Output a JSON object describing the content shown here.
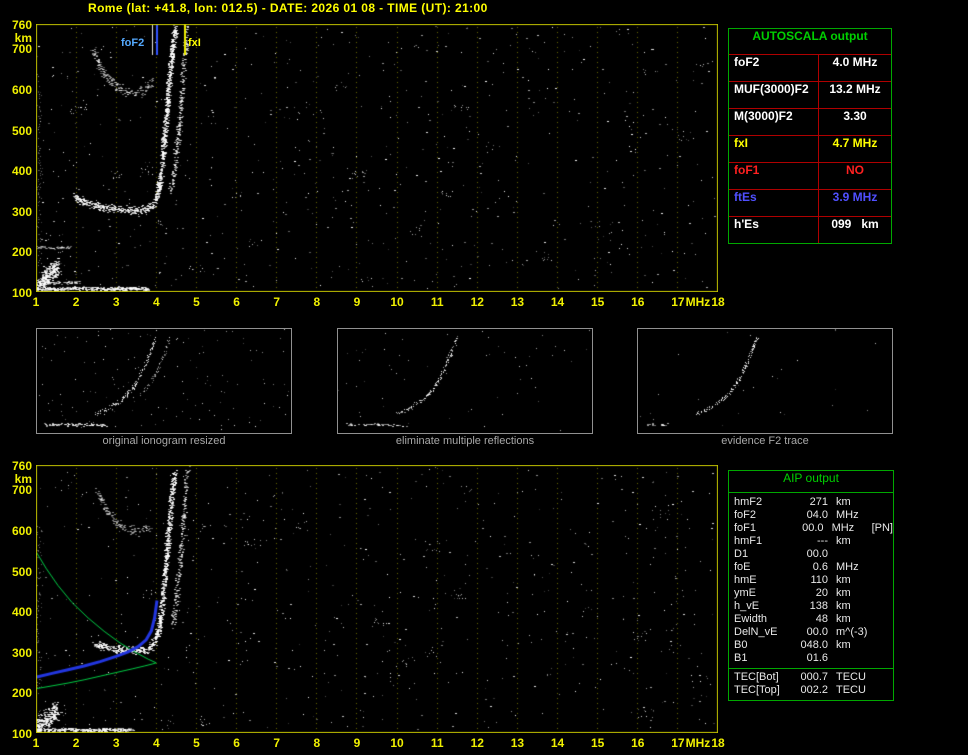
{
  "header": {
    "title": "Rome (lat: +41.8, lon: 012.5) - DATE: 2026 01 08 - TIME (UT): 21:00"
  },
  "autoscala_table": {
    "title": "AUTOSCALA output",
    "rows": [
      {
        "label": "foF2",
        "value": "4.0 MHz",
        "color": "#ffffff"
      },
      {
        "label": "MUF(3000)F2",
        "value": "13.2 MHz",
        "color": "#ffffff"
      },
      {
        "label": "M(3000)F2",
        "value": "3.30",
        "color": "#ffffff"
      },
      {
        "label": "fxI",
        "value": "4.7 MHz",
        "color": "#ffff00"
      },
      {
        "label": "foF1",
        "value": "NO",
        "color": "#ff2020"
      },
      {
        "label": "ftEs",
        "value": "3.9 MHz",
        "color": "#5050ff"
      },
      {
        "label": "h'Es",
        "value": "099   km",
        "color": "#ffffff"
      }
    ]
  },
  "aip_table": {
    "title": "AIP output",
    "rows": [
      {
        "label": "hmF2",
        "value": "271",
        "unit": "km",
        "extra": ""
      },
      {
        "label": "foF2",
        "value": "04.0",
        "unit": "MHz",
        "extra": ""
      },
      {
        "label": "foF1",
        "value": "00.0",
        "unit": "MHz",
        "extra": "[PN]"
      },
      {
        "label": "hmF1",
        "value": "---",
        "unit": "km",
        "extra": ""
      },
      {
        "label": "D1",
        "value": "00.0",
        "unit": "",
        "extra": ""
      },
      {
        "label": "foE",
        "value": "0.6",
        "unit": "MHz",
        "extra": ""
      },
      {
        "label": "hmE",
        "value": "110",
        "unit": "km",
        "extra": ""
      },
      {
        "label": "ymE",
        "value": "20",
        "unit": "km",
        "extra": ""
      },
      {
        "label": "h_vE",
        "value": "138",
        "unit": "km",
        "extra": ""
      },
      {
        "label": "Ewidth",
        "value": "48",
        "unit": "km",
        "extra": ""
      },
      {
        "label": "DelN_vE",
        "value": "00.0",
        "unit": "m^(-3)",
        "extra": ""
      },
      {
        "label": "B0",
        "value": "048.0",
        "unit": "km",
        "extra": ""
      },
      {
        "label": "B1",
        "value": "01.6",
        "unit": "",
        "extra": ""
      }
    ],
    "tec_rows": [
      {
        "label": "TEC[Bot]",
        "value": "000.7",
        "unit": "TECU"
      },
      {
        "label": "TEC[Top]",
        "value": "002.2",
        "unit": "TECU"
      }
    ]
  },
  "thumbnails": [
    {
      "caption": "original ionogram resized",
      "seed": 777,
      "noise": 140,
      "traces": [
        {
          "points": [
            [
              0.47,
              0.08
            ],
            [
              0.45,
              0.2
            ],
            [
              0.43,
              0.33
            ],
            [
              0.405,
              0.46
            ],
            [
              0.375,
              0.58
            ],
            [
              0.335,
              0.68
            ],
            [
              0.285,
              0.76
            ],
            [
              0.23,
              0.82
            ]
          ],
          "spread": 2.5,
          "samples": 170,
          "bright": 0.95,
          "w": 1
        },
        {
          "points": [
            [
              0.52,
              0.1
            ],
            [
              0.5,
              0.25
            ],
            [
              0.475,
              0.4
            ],
            [
              0.445,
              0.53
            ],
            [
              0.41,
              0.64
            ]
          ],
          "spread": 2.5,
          "samples": 70,
          "bright": 0.6,
          "w": 1
        },
        {
          "points": [
            [
              0.03,
              0.92
            ],
            [
              0.15,
              0.92
            ],
            [
              0.27,
              0.93
            ]
          ],
          "spread": 1.5,
          "samples": 80,
          "bright": 0.9,
          "w": 2
        }
      ]
    },
    {
      "caption": "eliminate multiple reflections",
      "seed": 888,
      "noise": 60,
      "traces": [
        {
          "points": [
            [
              0.47,
              0.08
            ],
            [
              0.45,
              0.2
            ],
            [
              0.43,
              0.33
            ],
            [
              0.405,
              0.46
            ],
            [
              0.375,
              0.58
            ],
            [
              0.335,
              0.68
            ],
            [
              0.285,
              0.76
            ],
            [
              0.23,
              0.82
            ]
          ],
          "spread": 2.5,
          "samples": 150,
          "bright": 0.95,
          "w": 1
        },
        {
          "points": [
            [
              0.03,
              0.92
            ],
            [
              0.15,
              0.92
            ],
            [
              0.27,
              0.93
            ]
          ],
          "spread": 1.5,
          "samples": 45,
          "bright": 0.85,
          "w": 2
        }
      ]
    },
    {
      "caption": "evidence F2 trace",
      "seed": 999,
      "noise": 25,
      "traces": [
        {
          "points": [
            [
              0.47,
              0.08
            ],
            [
              0.45,
              0.2
            ],
            [
              0.43,
              0.33
            ],
            [
              0.405,
              0.46
            ],
            [
              0.375,
              0.58
            ],
            [
              0.335,
              0.68
            ],
            [
              0.285,
              0.76
            ],
            [
              0.23,
              0.82
            ]
          ],
          "spread": 2.2,
          "samples": 160,
          "bright": 1.0,
          "w": 1
        },
        {
          "points": [
            [
              0.03,
              0.92
            ],
            [
              0.12,
              0.92
            ]
          ],
          "spread": 1.5,
          "samples": 15,
          "bright": 0.8,
          "w": 2
        }
      ]
    }
  ],
  "chart_data": [
    {
      "id": "ionogram-autoscaled",
      "type": "scatter",
      "title": "ionogram with autoscaled characteristics",
      "xlabel": "MHz",
      "ylabel": "km",
      "xlim": [
        1,
        18
      ],
      "ylim": [
        100,
        760
      ],
      "xticks": [
        1,
        2,
        3,
        4,
        5,
        6,
        7,
        8,
        9,
        10,
        11,
        12,
        13,
        14,
        15,
        16,
        17,
        18
      ],
      "yticks": [
        760,
        700,
        600,
        500,
        400,
        300,
        200,
        100
      ],
      "grid": "dotted-vertical",
      "markers": [
        {
          "name": "foF2",
          "label": "foF2",
          "freq_mhz": 4.0,
          "color": "#3355ff",
          "companion": true
        },
        {
          "name": "fxI",
          "label": "fxI",
          "freq_mhz": 4.7,
          "color": "#eeee00",
          "companion": false
        }
      ],
      "noise": {
        "dots": 620,
        "clusters": 28,
        "seed": 20260108
      },
      "traces": [
        {
          "name": "F2-ordinary",
          "points": [
            [
              1.95,
              332
            ],
            [
              2.3,
              316
            ],
            [
              2.7,
              306
            ],
            [
              3.1,
              301
            ],
            [
              3.5,
              299
            ],
            [
              3.75,
              302
            ],
            [
              3.9,
              312
            ],
            [
              4.0,
              330
            ],
            [
              4.08,
              362
            ],
            [
              4.15,
              415
            ],
            [
              4.2,
              475
            ],
            [
              4.26,
              545
            ],
            [
              4.32,
              615
            ],
            [
              4.4,
              690
            ],
            [
              4.48,
              752
            ]
          ],
          "spread": 12,
          "samples": 950,
          "bright": 1.0,
          "w": 2
        },
        {
          "name": "F2-extraordinary",
          "points": [
            [
              4.35,
              340
            ],
            [
              4.45,
              395
            ],
            [
              4.53,
              465
            ],
            [
              4.6,
              545
            ],
            [
              4.67,
              630
            ],
            [
              4.74,
              715
            ],
            [
              4.78,
              755
            ]
          ],
          "spread": 10,
          "samples": 260,
          "bright": 0.85,
          "w": 2
        },
        {
          "name": "second-hop",
          "points": [
            [
              2.4,
              702
            ],
            [
              2.6,
              652
            ],
            [
              2.85,
              618
            ],
            [
              3.15,
              596
            ],
            [
              3.45,
              588
            ],
            [
              3.7,
              594
            ],
            [
              3.9,
              618
            ]
          ],
          "spread": 16,
          "samples": 200,
          "bright": 0.6,
          "w": 2
        },
        {
          "name": "Es-layer",
          "points": [
            [
              1.0,
              105
            ],
            [
              1.5,
              104
            ],
            [
              2.1,
              106
            ],
            [
              2.7,
              105
            ],
            [
              3.3,
              106
            ],
            [
              3.8,
              105
            ]
          ],
          "spread": 5,
          "samples": 380,
          "bright": 0.9,
          "w": 2
        },
        {
          "name": "Es-second",
          "points": [
            [
              1.0,
              121
            ],
            [
              1.5,
              120
            ],
            [
              2.1,
              121
            ]
          ],
          "spread": 4,
          "samples": 90,
          "bright": 0.6,
          "w": 2
        },
        {
          "name": "low-blob",
          "points": [
            [
              1.0,
              112
            ],
            [
              1.15,
              124
            ],
            [
              1.3,
              138
            ],
            [
              1.45,
              150
            ],
            [
              1.55,
              160
            ]
          ],
          "spread": 30,
          "samples": 300,
          "bright": 0.95,
          "w": 2
        },
        {
          "name": "left-clutter",
          "points": [
            [
              1.05,
              170
            ],
            [
              1.1,
              240
            ],
            [
              1.05,
              320
            ],
            [
              1.12,
              400
            ],
            [
              1.06,
              480
            ],
            [
              1.1,
              560
            ],
            [
              1.05,
              640
            ]
          ],
          "spread": 60,
          "samples": 110,
          "bright": 0.45,
          "w": 1
        },
        {
          "name": "dash-200km",
          "points": [
            [
              1.05,
              208
            ],
            [
              1.5,
              206
            ],
            [
              1.9,
              207
            ]
          ],
          "spread": 4,
          "samples": 60,
          "bright": 0.5,
          "w": 2
        }
      ]
    },
    {
      "id": "ionogram-profile",
      "type": "scatter",
      "title": "ionogram with AIP electron density profile",
      "xlabel": "MHz",
      "ylabel": "km",
      "xlim": [
        1,
        18
      ],
      "ylim": [
        100,
        760
      ],
      "xticks": [
        1,
        2,
        3,
        4,
        5,
        6,
        7,
        8,
        9,
        10,
        11,
        12,
        13,
        14,
        15,
        16,
        17,
        18
      ],
      "yticks": [
        760,
        700,
        600,
        500,
        400,
        300,
        200,
        100
      ],
      "grid": "dotted-vertical",
      "markers": [],
      "noise": {
        "dots": 560,
        "clusters": 26,
        "seed": 90210
      },
      "traces": [
        {
          "name": "F2-ordinary",
          "points": [
            [
              2.45,
              318
            ],
            [
              2.8,
              308
            ],
            [
              3.2,
              302
            ],
            [
              3.55,
              300
            ],
            [
              3.8,
              304
            ],
            [
              3.95,
              318
            ],
            [
              4.05,
              345
            ],
            [
              4.12,
              392
            ],
            [
              4.18,
              450
            ],
            [
              4.25,
              520
            ],
            [
              4.3,
              590
            ],
            [
              4.37,
              665
            ],
            [
              4.45,
              740
            ]
          ],
          "spread": 12,
          "samples": 800,
          "bright": 1.0,
          "w": 2
        },
        {
          "name": "F2-extraordinary",
          "points": [
            [
              4.4,
              360
            ],
            [
              4.5,
              430
            ],
            [
              4.58,
              510
            ],
            [
              4.66,
              600
            ],
            [
              4.73,
              690
            ],
            [
              4.78,
              750
            ]
          ],
          "spread": 10,
          "samples": 220,
          "bright": 0.8,
          "w": 2
        },
        {
          "name": "second-hop",
          "points": [
            [
              2.5,
              700
            ],
            [
              2.75,
              650
            ],
            [
              3.0,
              618
            ],
            [
              3.3,
              600
            ],
            [
              3.6,
              594
            ],
            [
              3.85,
              604
            ]
          ],
          "spread": 14,
          "samples": 150,
          "bright": 0.55,
          "w": 2
        },
        {
          "name": "Es-layer",
          "points": [
            [
              1.0,
              104
            ],
            [
              1.6,
              105
            ],
            [
              2.2,
              104
            ],
            [
              2.8,
              105
            ],
            [
              3.4,
              105
            ]
          ],
          "spread": 5,
          "samples": 320,
          "bright": 0.9,
          "w": 2
        },
        {
          "name": "low-blob",
          "points": [
            [
              1.0,
              112
            ],
            [
              1.2,
              126
            ],
            [
              1.4,
              142
            ],
            [
              1.55,
              155
            ]
          ],
          "spread": 26,
          "samples": 260,
          "bright": 0.95,
          "w": 2
        },
        {
          "name": "left-clutter",
          "points": [
            [
              1.05,
              170
            ],
            [
              1.1,
              250
            ],
            [
              1.05,
              340
            ],
            [
              1.12,
              430
            ],
            [
              1.06,
              520
            ],
            [
              1.1,
              610
            ]
          ],
          "spread": 55,
          "samples": 90,
          "bright": 0.45,
          "w": 1
        }
      ],
      "curves": [
        {
          "name": "electron-density-profile-topside",
          "color": "#00cc44",
          "width": 1,
          "points": [
            [
              1.0,
              546
            ],
            [
              1.25,
              505
            ],
            [
              1.55,
              462
            ],
            [
              1.9,
              420
            ],
            [
              2.3,
              382
            ],
            [
              2.7,
              349
            ],
            [
              3.1,
              320
            ],
            [
              3.5,
              296
            ],
            [
              3.8,
              280
            ],
            [
              4.0,
              271
            ]
          ]
        },
        {
          "name": "electron-density-profile-bottomside",
          "color": "#00cc44",
          "width": 1,
          "points": [
            [
              1.0,
              207
            ],
            [
              1.4,
              214
            ],
            [
              1.8,
              221
            ],
            [
              2.2,
              229
            ],
            [
              2.6,
              238
            ],
            [
              3.0,
              247
            ],
            [
              3.4,
              256
            ],
            [
              3.7,
              263
            ],
            [
              3.9,
              268
            ],
            [
              4.0,
              271
            ]
          ]
        },
        {
          "name": "restored-F2-trace",
          "color": "#2236e0",
          "width": 3,
          "points": [
            [
              1.02,
              236
            ],
            [
              1.4,
              245
            ],
            [
              1.8,
              254
            ],
            [
              2.2,
              263
            ],
            [
              2.6,
              274
            ],
            [
              3.0,
              287
            ],
            [
              3.3,
              298
            ],
            [
              3.55,
              311
            ],
            [
              3.75,
              328
            ],
            [
              3.88,
              350
            ],
            [
              3.96,
              382
            ],
            [
              4.02,
              425
            ]
          ]
        }
      ],
      "annotations": {
        "hmF2_km": 271,
        "foF2_MHz": 4.0
      }
    }
  ]
}
